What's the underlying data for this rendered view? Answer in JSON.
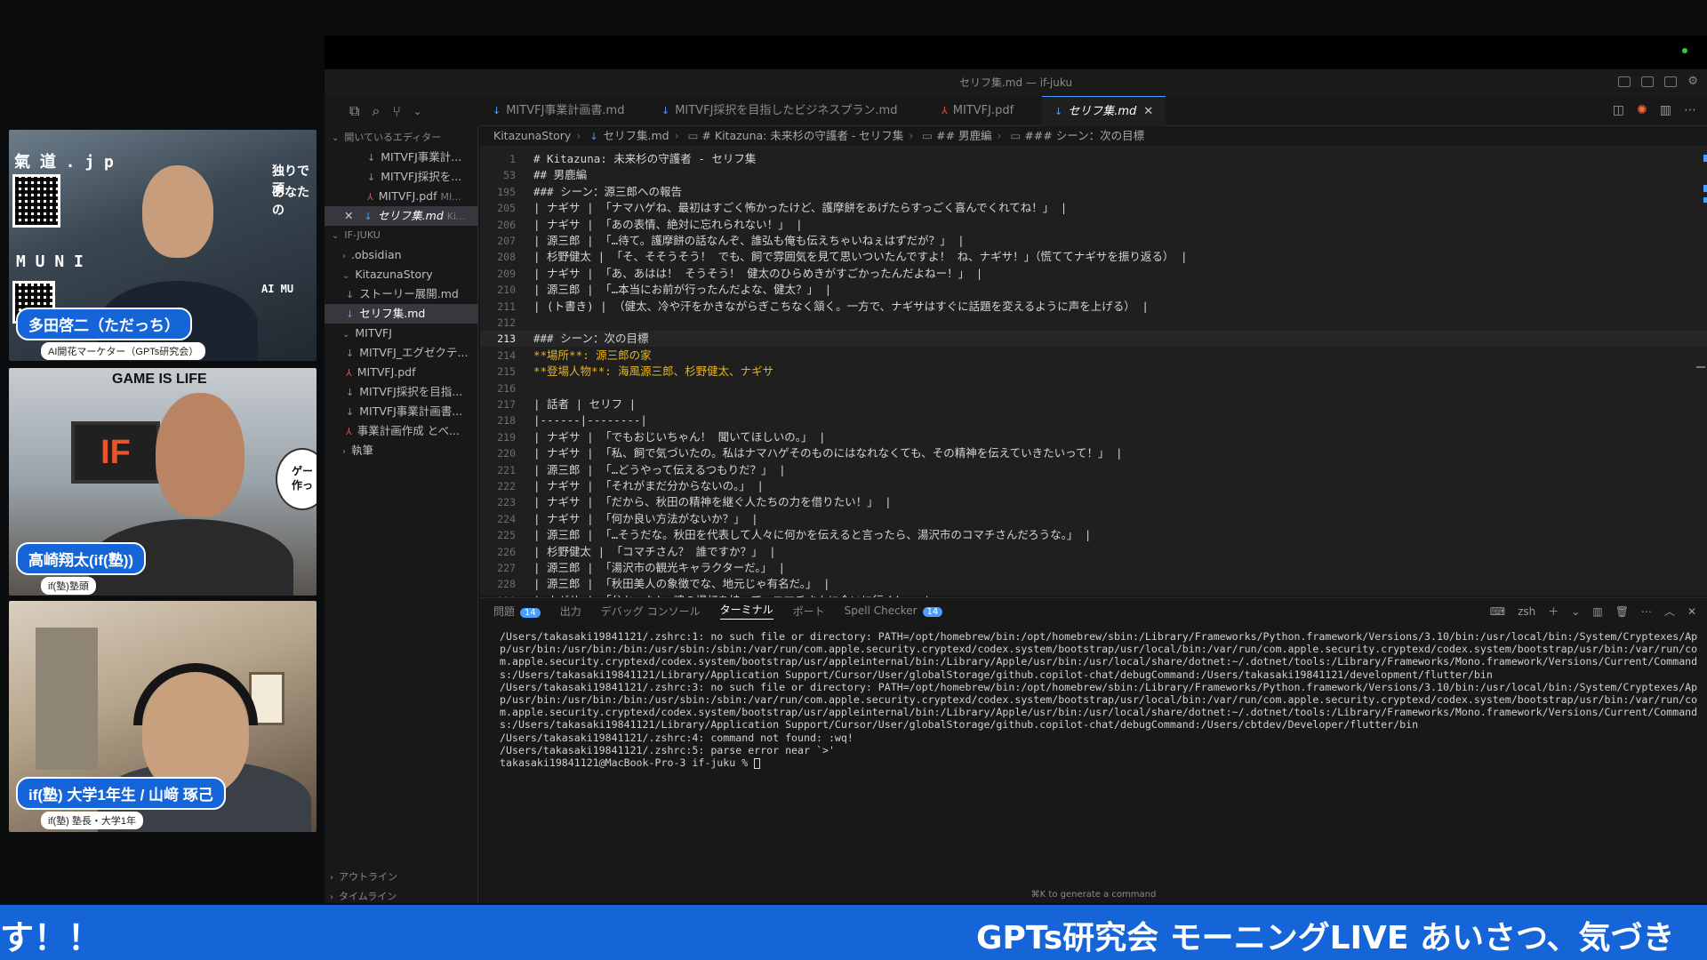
{
  "cams": [
    {
      "name": "多田啓二（ただっち）",
      "role": "AI開花マーケター（GPTs研究会）",
      "backdrop_texts": [
        "氣 道 . j p",
        "M U N I",
        "独りで頑",
        "あなたの",
        "AI MU"
      ]
    },
    {
      "name": "高崎翔太(if(塾))",
      "role": "if(塾)塾頭",
      "sign": "GAME IS LIFE",
      "logo": "IF",
      "bubble": "ゲー 作っ"
    },
    {
      "name": "if(塾) 大学1年生 / 山﨑 琢己",
      "role": "if(塾) 塾長・大学1年"
    }
  ],
  "window": {
    "title": "セリフ集.md — if-juku"
  },
  "sidebar": {
    "open_editors_label": "開いているエディター",
    "open_editors": [
      {
        "icon": "md",
        "label": "MITVFJ事業計...",
        "extra": ""
      },
      {
        "icon": "md",
        "label": "MITVFJ採択を...",
        "extra": ""
      },
      {
        "icon": "pdf",
        "label": "MITVFJ.pdf",
        "extra": "MI..."
      },
      {
        "icon": "md",
        "label": "セリフ集.md",
        "extra": "Ki..."
      }
    ],
    "workspace_label": "IF-JUKU",
    "tree": [
      {
        "kind": "folder",
        "indent": 1,
        "label": ".obsidian",
        "open": false
      },
      {
        "kind": "folder",
        "indent": 1,
        "label": "KitazunaStory",
        "open": true
      },
      {
        "kind": "md",
        "indent": 2,
        "label": "ストーリー展開.md"
      },
      {
        "kind": "md",
        "indent": 2,
        "label": "セリフ集.md",
        "active": true
      },
      {
        "kind": "folder",
        "indent": 1,
        "label": "MITVFJ",
        "open": true
      },
      {
        "kind": "md",
        "indent": 2,
        "label": "MITVFJ_エグゼクテ..."
      },
      {
        "kind": "pdf",
        "indent": 2,
        "label": "MITVFJ.pdf"
      },
      {
        "kind": "md",
        "indent": 2,
        "label": "MITVFJ採択を目指..."
      },
      {
        "kind": "md",
        "indent": 2,
        "label": "MITVFJ事業計画書..."
      },
      {
        "kind": "pdf",
        "indent": 2,
        "label": "事業計画作成 とべ..."
      },
      {
        "kind": "folder",
        "indent": 1,
        "label": "執筆",
        "open": false
      }
    ],
    "outline_label": "アウトライン",
    "timeline_label": "タイムライン"
  },
  "tabs": [
    {
      "icon": "md",
      "label": "MITVFJ事業計画書.md",
      "active": false
    },
    {
      "icon": "md",
      "label": "MITVFJ採択を目指したビジネスプラン.md",
      "active": false
    },
    {
      "icon": "pdf",
      "label": "MITVFJ.pdf",
      "active": false
    },
    {
      "icon": "md",
      "label": "セリフ集.md",
      "active": true
    }
  ],
  "breadcrumb": [
    "KitazunaStory",
    "セリフ集.md",
    "# Kitazuna: 未来杉の守護者 - セリフ集",
    "## 男鹿編",
    "### シーン：次の目標"
  ],
  "editor_lines": [
    {
      "n": "1",
      "text": "# Kitazuna: 未来杉の守護者 - セリフ集",
      "style": "heading"
    },
    {
      "n": "53",
      "text": "## 男鹿編",
      "style": "heading"
    },
    {
      "n": "195",
      "text": "### シーン：源三郎への報告",
      "style": "heading"
    },
    {
      "n": "205",
      "text": "| ナギサ | 「ナマハゲね、最初はすごく怖かったけど、護摩餅をあげたらすっごく喜んでくれてね！」 |",
      "style": ""
    },
    {
      "n": "206",
      "text": "| ナギサ | 「あの表情、絶対に忘れられない！」 |",
      "style": ""
    },
    {
      "n": "207",
      "text": "| 源三郎 | 「…待て。護摩餅の話なんぞ、誰弘も俺も伝えちゃいねぇはずだが？」 |",
      "style": ""
    },
    {
      "n": "208",
      "text": "| 杉野健太 | 「そ、そそうそう！ でも、飼で雰囲気を見て思いついたんですよ！ ね、ナギサ！」（慌ててナギサを振り返る） |",
      "style": ""
    },
    {
      "n": "209",
      "text": "| ナギサ | 「あ、あはは！ そうそう！ 健太のひらめきがすごかったんだよねー！」 |",
      "style": ""
    },
    {
      "n": "210",
      "text": "| 源三郎 | 「…本当にお前が行ったんだよな、健太？」 |",
      "style": ""
    },
    {
      "n": "211",
      "text": "| (ト書き) | （健太、冷や汗をかきながらぎこちなく頷く。一方で、ナギサはすぐに話題を変えるように声を上げる） |",
      "style": ""
    },
    {
      "n": "212",
      "text": "",
      "style": ""
    },
    {
      "n": "213",
      "text": "### シーン：次の目標",
      "style": "heading",
      "current": true
    },
    {
      "n": "214",
      "text": "**場所**: 源三郎の家",
      "style": "bold"
    },
    {
      "n": "215",
      "text": "**登場人物**: 海風源三郎、杉野健太、ナギサ",
      "style": "bold"
    },
    {
      "n": "216",
      "text": "",
      "style": ""
    },
    {
      "n": "217",
      "text": "| 話者 | セリフ |",
      "style": ""
    },
    {
      "n": "218",
      "text": "|------|--------|",
      "style": ""
    },
    {
      "n": "219",
      "text": "| ナギサ | 「でもおじいちゃん！ 聞いてほしいの。」 |",
      "style": ""
    },
    {
      "n": "220",
      "text": "| ナギサ | 「私、飼で気づいたの。私はナマハゲそのものにはなれなくても、その精神を伝えていきたいって！」 |",
      "style": ""
    },
    {
      "n": "221",
      "text": "| 源三郎 | 「…どうやって伝えるつもりだ？」 |",
      "style": ""
    },
    {
      "n": "222",
      "text": "| ナギサ | 「それがまだ分からないの。」 |",
      "style": ""
    },
    {
      "n": "223",
      "text": "| ナギサ | 「だから、秋田の精神を継ぐ人たちの力を借りたい！」 |",
      "style": ""
    },
    {
      "n": "224",
      "text": "| ナギサ | 「何か良い方法がないか？」 |",
      "style": ""
    },
    {
      "n": "225",
      "text": "| 源三郎 | 「…そうだな。秋田を代表して人々に何かを伝えると言ったら、湯沢市のコマチさんだろうな。」 |",
      "style": ""
    },
    {
      "n": "226",
      "text": "| 杉野健太 | 「コマチさん？ 誰ですか？」 |",
      "style": ""
    },
    {
      "n": "227",
      "text": "| 源三郎 | 「湯沢市の観光キャラクターだ。」 |",
      "style": ""
    },
    {
      "n": "228",
      "text": "| 源三郎 | 「秋田美人の象徴でな、地元じゃ有名だ。」 |",
      "style": ""
    },
    {
      "n": "229",
      "text": "| ナギサ | 「分かった！ 魂の提灯を持って、コマチさんに会いに行く！」 |",
      "style": ""
    }
  ],
  "panel": {
    "tabs": [
      {
        "label": "問題",
        "badge": "14",
        "active": false
      },
      {
        "label": "出力",
        "badge": "",
        "active": false
      },
      {
        "label": "デバッグ コンソール",
        "badge": "",
        "active": false
      },
      {
        "label": "ターミナル",
        "badge": "",
        "active": true
      },
      {
        "label": "ポート",
        "badge": "",
        "active": false
      },
      {
        "label": "Spell Checker",
        "badge": "14",
        "active": false
      }
    ],
    "shell": "zsh",
    "terminal_lines": [
      "/Users/takasaki19841121/.zshrc:1: no such file or directory: PATH=/opt/homebrew/bin:/opt/homebrew/sbin:/Library/Frameworks/Python.framework/Versions/3.10/bin:/usr/local/bin:/System/Cryptexes/App/usr/bin:/usr/bin:/bin:/usr/sbin:/sbin:/var/run/com.apple.security.cryptexd/codex.system/bootstrap/usr/local/bin:/var/run/com.apple.security.cryptexd/codex.system/bootstrap/usr/bin:/var/run/com.apple.security.cryptexd/codex.system/bootstrap/usr/appleinternal/bin:/Library/Apple/usr/bin:/usr/local/share/dotnet:~/.dotnet/tools:/Library/Frameworks/Mono.framework/Versions/Current/Commands:/Users/takasaki19841121/Library/Application Support/Cursor/User/globalStorage/github.copilot-chat/debugCommand:/Users/takasaki19841121/development/flutter/bin",
      "/Users/takasaki19841121/.zshrc:3: no such file or directory: PATH=/opt/homebrew/bin:/opt/homebrew/sbin:/Library/Frameworks/Python.framework/Versions/3.10/bin:/usr/local/bin:/System/Cryptexes/App/usr/bin:/usr/bin:/bin:/usr/sbin:/sbin:/var/run/com.apple.security.cryptexd/codex.system/bootstrap/usr/local/bin:/var/run/com.apple.security.cryptexd/codex.system/bootstrap/usr/bin:/var/run/com.apple.security.cryptexd/codex.system/bootstrap/usr/appleinternal/bin:/Library/Apple/usr/bin:/usr/local/share/dotnet:~/.dotnet/tools:/Library/Frameworks/Mono.framework/Versions/Current/Commands:/Users/takasaki19841121/Library/Application Support/Cursor/User/globalStorage/github.copilot-chat/debugCommand:/Users/cbtdev/Developer/flutter/bin",
      "/Users/takasaki19841121/.zshrc:4: command not found: :wq!",
      "/Users/takasaki19841121/.zshrc:5: parse error near `>'",
      "takasaki19841121@MacBook-Pro-3 if-juku % "
    ],
    "hint": "⌘K to generate a command"
  },
  "ticker": {
    "left": "す！！",
    "right": "GPTs研究会 モーニングLIVE あいさつ、気づき"
  }
}
